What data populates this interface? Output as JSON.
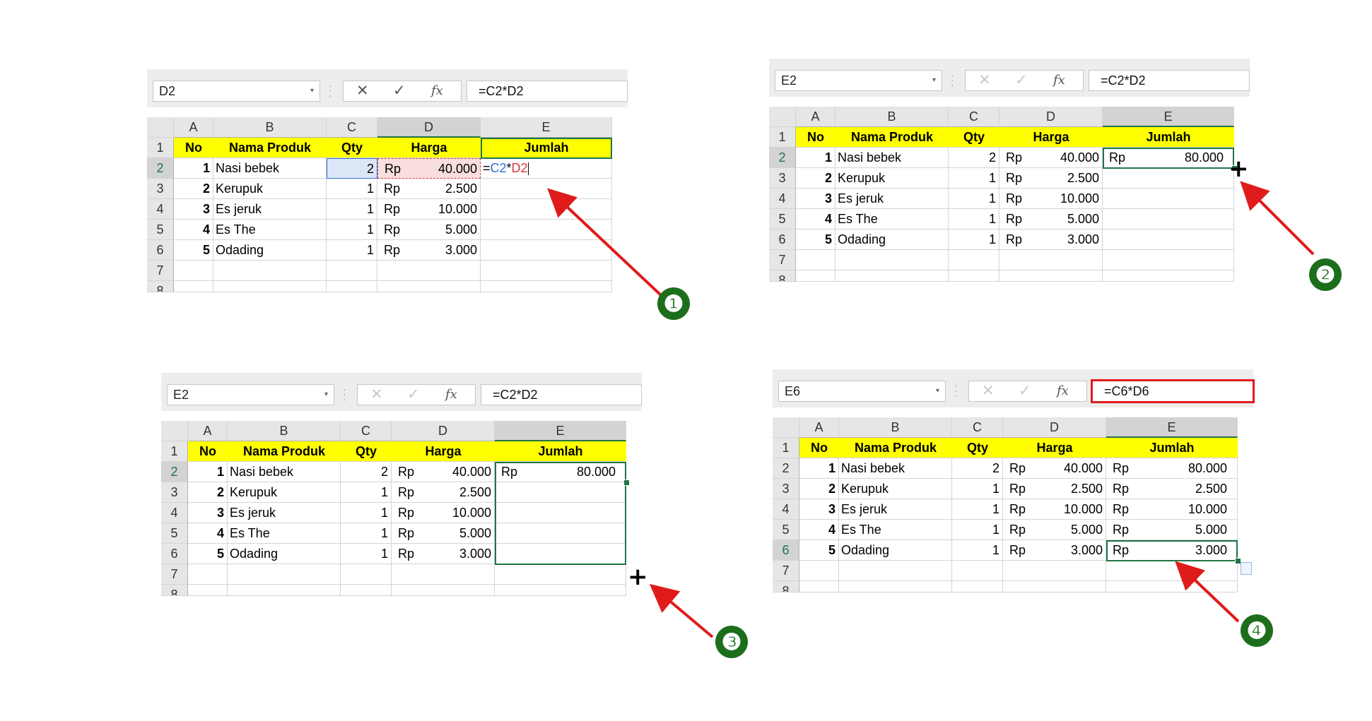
{
  "sheet": {
    "col_letters": [
      "A",
      "B",
      "C",
      "D",
      "E"
    ],
    "row_numbers": [
      "1",
      "2",
      "3",
      "4",
      "5",
      "6",
      "7",
      "8"
    ],
    "header_row": {
      "no": "No",
      "nama": "Nama Produk",
      "qty": "Qty",
      "harga": "Harga",
      "jumlah": "Jumlah"
    },
    "rows": [
      {
        "no": "1",
        "nama": "Nasi bebek",
        "qty": "2",
        "rp": "Rp",
        "harga": "40.000"
      },
      {
        "no": "2",
        "nama": "Kerupuk",
        "qty": "1",
        "rp": "Rp",
        "harga": "2.500"
      },
      {
        "no": "3",
        "nama": "Es jeruk",
        "qty": "1",
        "rp": "Rp",
        "harga": "10.000"
      },
      {
        "no": "4",
        "nama": "Es The",
        "qty": "1",
        "rp": "Rp",
        "harga": "5.000"
      },
      {
        "no": "5",
        "nama": "Odading",
        "qty": "1",
        "rp": "Rp",
        "harga": "3.000"
      }
    ]
  },
  "panels": [
    {
      "step": "❶",
      "name_box": "D2",
      "formula": "=C2*D2",
      "editing": {
        "eq": "=",
        "c": "C2",
        "op": "*",
        "d": "D2"
      },
      "jumlah": [
        "",
        "",
        "",
        "",
        ""
      ]
    },
    {
      "step": "❷",
      "name_box": "E2",
      "formula": "=C2*D2",
      "jumlah_rp": [
        "Rp",
        "",
        "",
        "",
        ""
      ],
      "jumlah": [
        "80.000",
        "",
        "",
        "",
        ""
      ]
    },
    {
      "step": "❸",
      "name_box": "E2",
      "formula": "=C2*D2",
      "jumlah_rp": [
        "Rp",
        "",
        "",
        "",
        ""
      ],
      "jumlah": [
        "80.000",
        "",
        "",
        "",
        ""
      ]
    },
    {
      "step": "❹",
      "name_box": "E6",
      "formula": "=C6*D6",
      "jumlah_rp": [
        "Rp",
        "Rp",
        "Rp",
        "Rp",
        "Rp"
      ],
      "jumlah": [
        "80.000",
        "2.500",
        "10.000",
        "5.000",
        "3.000"
      ]
    }
  ],
  "icons": {
    "cancel": "✕",
    "enter": "✓",
    "function": "fx",
    "fill_cursor": "+"
  },
  "colors": {
    "header_fill": "#ffff00",
    "selection": "#217346",
    "arrow": "#e01b1b",
    "step_badge": "#1c6e1c",
    "ref_blue": "#2f6fd6",
    "ref_red": "#d43b3b"
  }
}
